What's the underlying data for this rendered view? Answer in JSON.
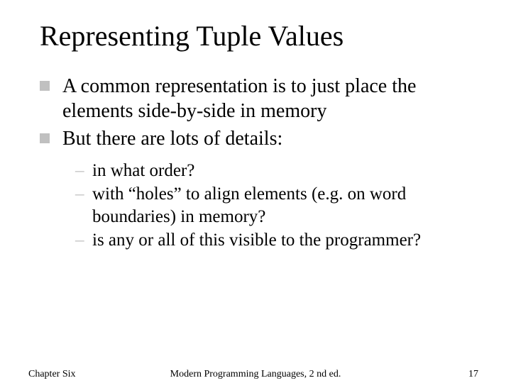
{
  "title": "Representing Tuple Values",
  "bullets": {
    "b1": "A common representation is to just place the elements side-by-side in memory",
    "b2": "But there are lots of details:"
  },
  "subbullets": {
    "s1": "in what order?",
    "s2": "with “holes” to align elements (e.g. on word boundaries) in memory?",
    "s3": "is any or all of this visible to the programmer?"
  },
  "footer": {
    "left": "Chapter Six",
    "center": "Modern Programming Languages, 2 nd ed.",
    "right": "17"
  }
}
